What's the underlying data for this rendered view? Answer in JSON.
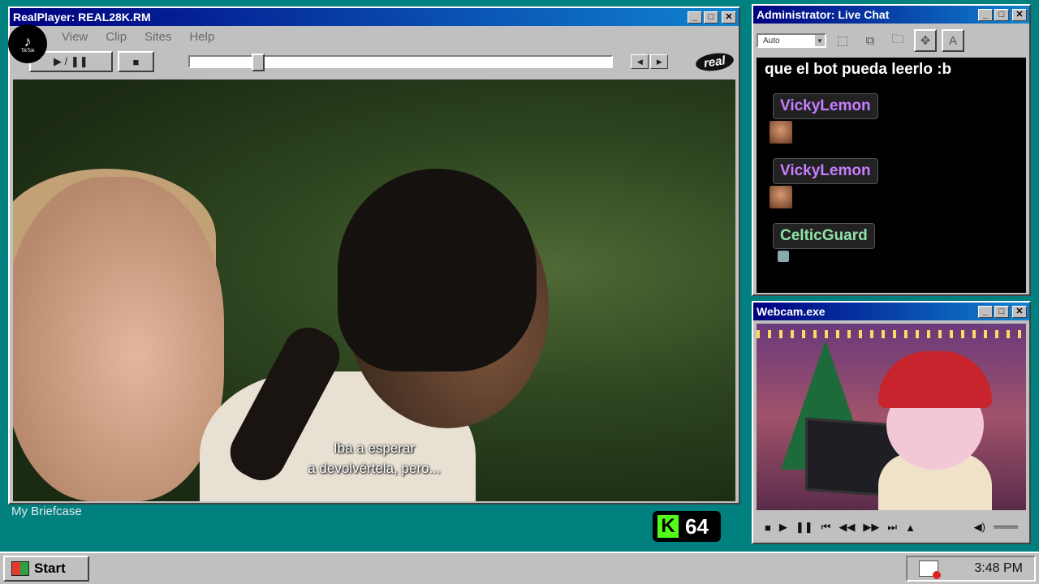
{
  "realplayer": {
    "title": "RealPlayer: REAL28K.RM",
    "menu": [
      "View",
      "Clip",
      "Sites",
      "Help"
    ],
    "play_pause_label": "▶ / ❚❚",
    "stop_label": "■",
    "seek_position": 0.15,
    "logo_text": "real",
    "subtitle_line1": "Iba a esperar",
    "subtitle_line2": "a devolvértela, pero..."
  },
  "tiktok": {
    "glyph": "♪",
    "label": "TikTok"
  },
  "chat": {
    "title": "Administrator: Live Chat",
    "font_select": "Auto",
    "last_message": "que el bot pueda leerlo :b",
    "messages": [
      {
        "user": "VickyLemon",
        "color": "#c77dff"
      },
      {
        "user": "VickyLemon",
        "color": "#c77dff"
      },
      {
        "user": "CelticGuard",
        "color": "#8fe3a8"
      }
    ]
  },
  "webcam": {
    "title": "Webcam.exe"
  },
  "desktop": {
    "briefcase_label": "My Briefcase"
  },
  "kick": {
    "letter": "K",
    "count": "64",
    "brand_color": "#53fc18"
  },
  "taskbar": {
    "start_label": "Start",
    "clock": "3:48 PM"
  }
}
